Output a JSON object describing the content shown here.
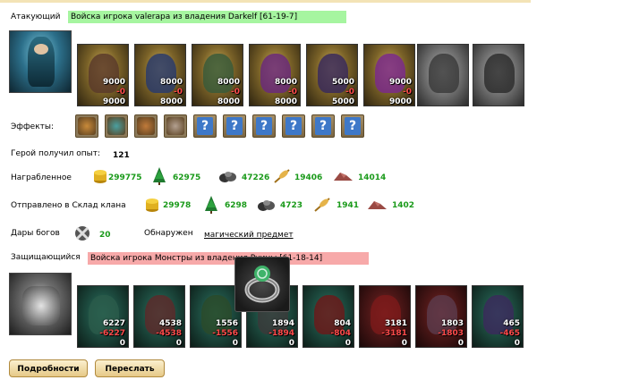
{
  "attacker": {
    "label": "Атакующий",
    "banner": "Войска игрока valerapa из владения Darkelf [61-19-7]",
    "banner_color": "#a6f5a0",
    "units": [
      {
        "name": "unit-1",
        "top": "9000",
        "loss": "-0",
        "bottom": "9000"
      },
      {
        "name": "unit-2",
        "top": "8000",
        "loss": "-0",
        "bottom": "8000"
      },
      {
        "name": "unit-3",
        "top": "8000",
        "loss": "-0",
        "bottom": "8000"
      },
      {
        "name": "unit-4",
        "top": "8000",
        "loss": "-0",
        "bottom": "8000"
      },
      {
        "name": "unit-5",
        "top": "5000",
        "loss": "-0",
        "bottom": "5000"
      },
      {
        "name": "unit-6",
        "top": "9000",
        "loss": "-0",
        "bottom": "9000"
      }
    ]
  },
  "effects": {
    "label": "Эффекты:",
    "icons": [
      "beast-effect-icon",
      "sword-effect-icon",
      "heal-effect-icon",
      "hand-effect-icon",
      "question-icon",
      "question-icon",
      "question-icon",
      "question-icon",
      "question-icon",
      "question-icon"
    ]
  },
  "experience": {
    "label": "Герой получил опыт:",
    "value": "121"
  },
  "loot": {
    "label": "Награбленное",
    "gold": "299775",
    "wood": "62975",
    "ore": "47226",
    "grain": "19406",
    "stone": "14014"
  },
  "clan_storage": {
    "label": "Отправлено в Склад клана",
    "gold": "29978",
    "wood": "6298",
    "ore": "4723",
    "grain": "1941",
    "stone": "1402"
  },
  "gifts": {
    "label": "Дары богов",
    "value": "20",
    "found_label": "Обнаружен",
    "found_link": "магический предмет"
  },
  "defender": {
    "label": "Защищающийся",
    "banner": "Войска игрока Монстры из владения Руины [61-18-14]",
    "banner_color": "#f7a9a9",
    "units": [
      {
        "name": "unit-1",
        "top": "6227",
        "loss": "-6227",
        "bottom": "0"
      },
      {
        "name": "unit-2",
        "top": "4538",
        "loss": "-4538",
        "bottom": "0"
      },
      {
        "name": "unit-3",
        "top": "1556",
        "loss": "-1556",
        "bottom": "0"
      },
      {
        "name": "unit-4",
        "top": "1894",
        "loss": "-1894",
        "bottom": "0"
      },
      {
        "name": "unit-5",
        "top": "804",
        "loss": "-804",
        "bottom": "0"
      },
      {
        "name": "unit-6",
        "top": "3181",
        "loss": "-3181",
        "bottom": "0"
      },
      {
        "name": "unit-7",
        "top": "1803",
        "loss": "-1803",
        "bottom": "0"
      },
      {
        "name": "unit-8",
        "top": "465",
        "loss": "-465",
        "bottom": "0"
      }
    ]
  },
  "buttons": {
    "details": "Подробности",
    "forward": "Переслать"
  }
}
